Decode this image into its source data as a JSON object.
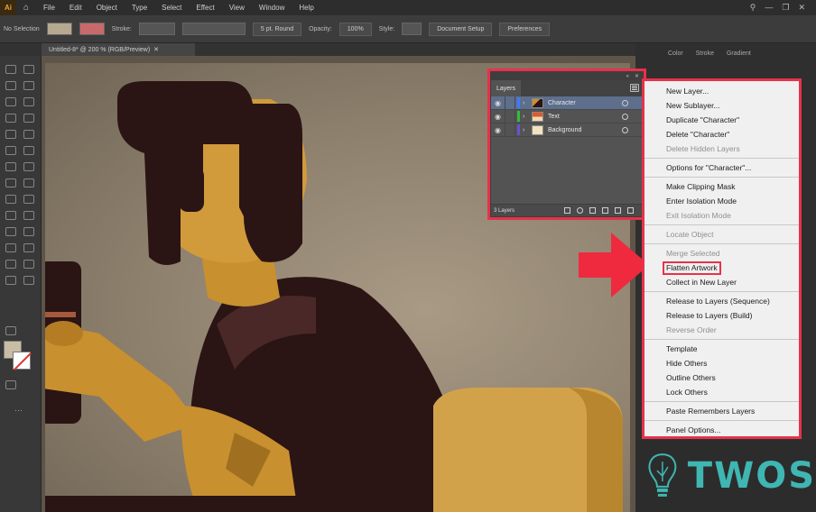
{
  "menubar": {
    "logo": "Ai",
    "items": [
      "File",
      "Edit",
      "Object",
      "Type",
      "Select",
      "Effect",
      "View",
      "Window",
      "Help"
    ]
  },
  "controlbar": {
    "selection": "No Selection",
    "stroke_label": "Stroke:",
    "brush": "5 pt. Round",
    "opacity_label": "Opacity:",
    "opacity_value": "100%",
    "style_label": "Style:",
    "document_setup": "Document Setup",
    "preferences": "Preferences"
  },
  "document": {
    "tab_title": "Untitled-8* @ 200 % (RGB/Preview)"
  },
  "dock": {
    "tabs": [
      "Color",
      "Stroke",
      "Gradient"
    ]
  },
  "layers_panel": {
    "title": "Layers",
    "layers": [
      {
        "name": "Character",
        "color": "#3d7bff",
        "selected": true
      },
      {
        "name": "Text",
        "color": "#2fbf3a",
        "selected": false
      },
      {
        "name": "Background",
        "color": "#6a52c8",
        "selected": false
      }
    ],
    "footer_count": "3 Layers"
  },
  "flyout_menu": {
    "groups": [
      [
        {
          "label": "New Layer...",
          "enabled": true
        },
        {
          "label": "New Sublayer...",
          "enabled": true
        },
        {
          "label": "Duplicate \"Character\"",
          "enabled": true
        },
        {
          "label": "Delete \"Character\"",
          "enabled": true
        },
        {
          "label": "Delete Hidden Layers",
          "enabled": false
        }
      ],
      [
        {
          "label": "Options for \"Character\"...",
          "enabled": true
        }
      ],
      [
        {
          "label": "Make Clipping Mask",
          "enabled": true
        },
        {
          "label": "Enter Isolation Mode",
          "enabled": true
        },
        {
          "label": "Exit Isolation Mode",
          "enabled": false
        }
      ],
      [
        {
          "label": "Locate Object",
          "enabled": false
        }
      ],
      [
        {
          "label": "Merge Selected",
          "enabled": false
        },
        {
          "label": "Flatten Artwork",
          "enabled": true,
          "highlighted": true
        },
        {
          "label": "Collect in New Layer",
          "enabled": true
        }
      ],
      [
        {
          "label": "Release to Layers (Sequence)",
          "enabled": true
        },
        {
          "label": "Release to Layers (Build)",
          "enabled": true
        },
        {
          "label": "Reverse Order",
          "enabled": false
        }
      ],
      [
        {
          "label": "Template",
          "enabled": true
        },
        {
          "label": "Hide Others",
          "enabled": true
        },
        {
          "label": "Outline Others",
          "enabled": true
        },
        {
          "label": "Lock Others",
          "enabled": true
        }
      ],
      [
        {
          "label": "Paste Remembers Layers",
          "enabled": true
        }
      ],
      [
        {
          "label": "Panel Options...",
          "enabled": true
        }
      ]
    ]
  },
  "watermark": {
    "text": "TWOS"
  },
  "colors": {
    "highlight_red": "#e8314a",
    "watermark_teal": "#3fb6b2",
    "hair_dark": "#2a1414",
    "skin": "#c8902f"
  }
}
